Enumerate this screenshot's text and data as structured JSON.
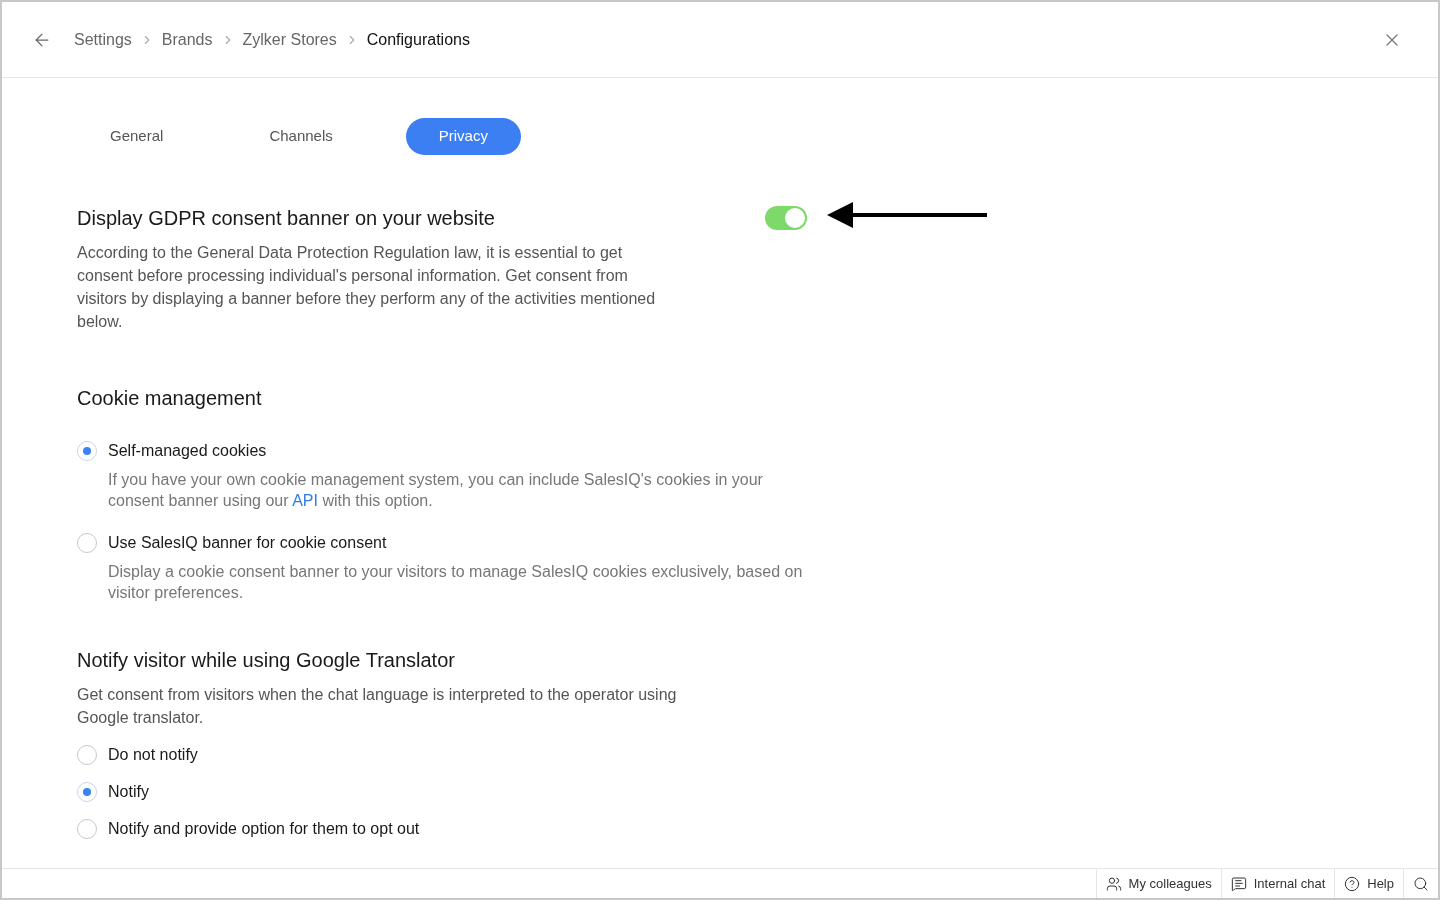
{
  "breadcrumb": [
    {
      "label": "Settings",
      "current": false
    },
    {
      "label": "Brands",
      "current": false
    },
    {
      "label": "Zylker Stores",
      "current": false
    },
    {
      "label": "Configurations",
      "current": true
    }
  ],
  "tabs": [
    {
      "label": "General",
      "selected": false
    },
    {
      "label": "Channels",
      "selected": false
    },
    {
      "label": "Privacy",
      "selected": true
    }
  ],
  "gdpr": {
    "title": "Display GDPR consent banner on your website",
    "on": true,
    "description": "According to the General Data Protection Regulation law, it is essential to get consent before processing individual's personal information. Get consent from visitors by displaying a banner before they perform any of the activities mentioned below."
  },
  "cookie_management": {
    "title": "Cookie management",
    "options": [
      {
        "label": "Self-managed cookies",
        "selected": true,
        "description_before": "If you have your own cookie management system, you can include SalesIQ's cookies in your consent banner using our",
        "link": "API",
        "description_after": "with this option."
      },
      {
        "label": "Use SalesIQ banner for cookie consent",
        "selected": false,
        "description_before": "Display a cookie consent banner to your visitors to manage SalesIQ cookies exclusively, based on visitor preferences."
      }
    ]
  },
  "translator": {
    "title": "Notify visitor while using Google Translator",
    "description": "Get consent from visitors when the chat language is interpreted to the operator using Google translator.",
    "options": [
      {
        "label": "Do not notify",
        "selected": false
      },
      {
        "label": "Notify",
        "selected": true
      },
      {
        "label": "Notify and provide option for them to opt out",
        "selected": false
      }
    ]
  },
  "footer": [
    {
      "kind": "colleagues",
      "label": "My colleagues"
    },
    {
      "kind": "chat",
      "label": "Internal chat"
    },
    {
      "kind": "help",
      "label": "Help"
    },
    {
      "kind": "search"
    }
  ]
}
